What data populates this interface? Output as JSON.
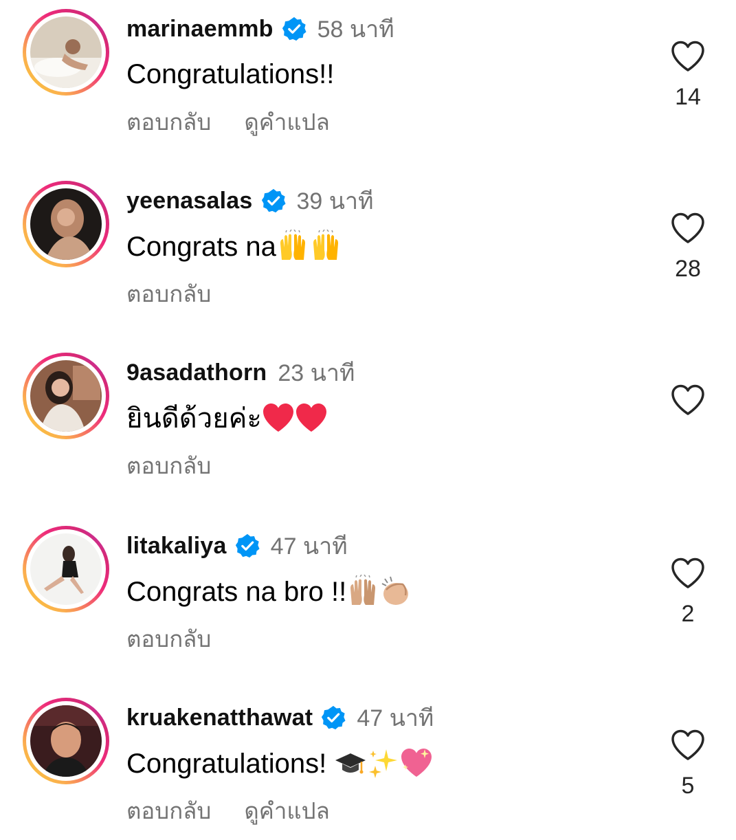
{
  "comments": [
    {
      "username": "marinaemmb",
      "verified": true,
      "time": "58 นาที",
      "text": "Congratulations!!",
      "emojis": [],
      "reply_label": "ตอบกลับ",
      "translate_label": "ดูคำแปล",
      "likes": "14"
    },
    {
      "username": "yeenasalas",
      "verified": true,
      "time": "39 นาที",
      "text": "Congrats na",
      "emojis": [
        "raising-hands-emoji",
        "raising-hands-emoji"
      ],
      "reply_label": "ตอบกลับ",
      "translate_label": "",
      "likes": "28"
    },
    {
      "username": "9asadathorn",
      "verified": false,
      "time": "23 นาที",
      "text": "ยินดีด้วยค่ะ",
      "emojis": [
        "red-heart-emoji",
        "red-heart-emoji"
      ],
      "reply_label": "ตอบกลับ",
      "translate_label": "",
      "likes": ""
    },
    {
      "username": "litakaliya",
      "verified": true,
      "time": "47 นาที",
      "text": "Congrats na bro !!",
      "emojis": [
        "raising-hands-tone-emoji",
        "clapping-hands-tone-emoji"
      ],
      "reply_label": "ตอบกลับ",
      "translate_label": "",
      "likes": "2"
    },
    {
      "username": "kruakenatthawat",
      "verified": true,
      "time": "47 นาที",
      "text": "Congratulations! ",
      "emojis": [
        "graduation-cap-emoji",
        "sparkles-emoji",
        "sparkling-heart-emoji"
      ],
      "reply_label": "ตอบกลับ",
      "translate_label": "ดูคำแปล",
      "likes": "5"
    }
  ],
  "colors": {
    "verified_badge": "#0095f6",
    "secondary_text": "#737373",
    "heart_outline": "#262626",
    "story_ring_start": "#f9ce34",
    "story_ring_end": "#b23bd1"
  }
}
